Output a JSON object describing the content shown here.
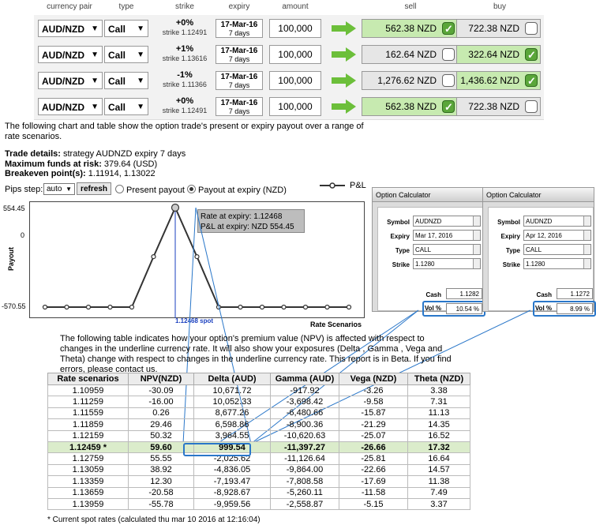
{
  "orders": {
    "headers": [
      "currency pair",
      "type",
      "strike",
      "expiry",
      "amount",
      "sell",
      "buy"
    ],
    "rows": [
      {
        "pair": "AUD/NZD",
        "type": "Call",
        "pct": "+0%",
        "strike": "strike 1.12491",
        "exp_date": "17-Mar-16",
        "exp_days": "7 days",
        "amount": "100,000",
        "sell": "562.38 NZD",
        "buy": "722.38 NZD",
        "sell_checked": true,
        "buy_checked": false
      },
      {
        "pair": "AUD/NZD",
        "type": "Call",
        "pct": "+1%",
        "strike": "strike 1.13616",
        "exp_date": "17-Mar-16",
        "exp_days": "7 days",
        "amount": "100,000",
        "sell": "162.64 NZD",
        "buy": "322.64 NZD",
        "sell_checked": false,
        "buy_checked": true
      },
      {
        "pair": "AUD/NZD",
        "type": "Call",
        "pct": "-1%",
        "strike": "strike 1.11366",
        "exp_date": "17-Mar-16",
        "exp_days": "7 days",
        "amount": "100,000",
        "sell": "1,276.62 NZD",
        "buy": "1,436.62 NZD",
        "sell_checked": false,
        "buy_checked": true
      },
      {
        "pair": "AUD/NZD",
        "type": "Call",
        "pct": "+0%",
        "strike": "strike 1.12491",
        "exp_date": "17-Mar-16",
        "exp_days": "7 days",
        "amount": "100,000",
        "sell": "562.38 NZD",
        "buy": "722.38 NZD",
        "sell_checked": true,
        "buy_checked": false
      }
    ]
  },
  "intro": "The following chart and table show the option trade's present or expiry payout over a range of rate scenarios.",
  "details": {
    "trade_label": "Trade details:",
    "trade_value": " strategy AUDNZD expiry 7 days",
    "funds_label": "Maximum funds at risk:",
    "funds_value": " 379.64 (USD)",
    "breakeven_label": "Breakeven point(s):",
    "breakeven_value": " 1.11914, 1.13022"
  },
  "controls": {
    "pips_label": "Pips step:",
    "pips_value": "auto",
    "refresh": "refresh",
    "present": "Present payout",
    "expiry": "Payout at expiry (NZD)",
    "legend": "P&L"
  },
  "chart_data": {
    "type": "line",
    "ylabel": "Payout",
    "xlabel": "Rate Scenarios",
    "y_ticks": [
      "554.45",
      "0",
      "-570.55"
    ],
    "ylim": [
      -570.55,
      554.45
    ],
    "spot_label": "1.12468 spot",
    "tooltip": [
      "Rate at expiry: 1.12468",
      "P&L at expiry: NZD 554.45"
    ],
    "x": [
      1,
      2,
      3,
      4,
      5,
      6,
      7,
      8,
      9,
      10,
      11,
      12,
      13,
      14,
      15
    ],
    "values": [
      -570.55,
      -570.55,
      -570.55,
      -570.55,
      -570.55,
      0,
      554.45,
      0,
      -570.55,
      -570.55,
      -570.55,
      -570.55,
      -570.55,
      -570.55,
      -570.55
    ],
    "spot_index": 6,
    "color": "#333333",
    "spot_color": "#1a3fbf"
  },
  "calc1": {
    "title": "Option Calculator",
    "symbol_l": "Symbol",
    "symbol": "AUDNZD",
    "expiry_l": "Expiry",
    "expiry": "Mar 17, 2016",
    "type_l": "Type",
    "type": "CALL",
    "strike_l": "Strike",
    "strike": "1.1280",
    "cash_l": "Cash",
    "cash": "1.1282",
    "vol_l": "Vol %",
    "vol": "10.54 %"
  },
  "calc2": {
    "title": "Option Calculator",
    "symbol_l": "Symbol",
    "symbol": "AUDNZD",
    "expiry_l": "Expiry",
    "expiry": "Apr 12, 2016",
    "type_l": "Type",
    "type": "CALL",
    "strike_l": "Strike",
    "strike": "1.1280",
    "cash_l": "Cash",
    "cash": "1.1272",
    "vol_l": "Vol %",
    "vol": "8.99 %"
  },
  "npv_text": "The following table indicates how your option's premium value (NPV) is affected with respect to changes in the underline currency rate. It will also show your exposures (Delta , Gamma , Vega and Theta) change with respect to changes in the underline currency rate. This report is in Beta. If you find errors, please contact us.",
  "table": {
    "headers": [
      "Rate scenarios",
      "NPV(NZD)",
      "Delta (AUD)",
      "Gamma (AUD)",
      "Vega (NZD)",
      "Theta (NZD)"
    ],
    "rows": [
      [
        "1.10959",
        "-30.09",
        "10,671.72",
        "-917.92",
        "-3.26",
        "3.38"
      ],
      [
        "1.11259",
        "-16.00",
        "10,052.33",
        "-3,698.42",
        "-9.58",
        "7.31"
      ],
      [
        "1.11559",
        "0.26",
        "8,677.26",
        "-6,480.66",
        "-15.87",
        "11.13"
      ],
      [
        "1.11859",
        "29.46",
        "6,598.86",
        "-8,900.36",
        "-21.29",
        "14.35"
      ],
      [
        "1.12159",
        "50.32",
        "3,964.55",
        "-10,620.63",
        "-25.07",
        "16.52"
      ],
      [
        "1.12459 *",
        "59.60",
        "999.54",
        "-11,397.27",
        "-26.66",
        "17.32"
      ],
      [
        "1.12759",
        "55.55",
        "-2,025.62",
        "-11,126.64",
        "-25.81",
        "16.64"
      ],
      [
        "1.13059",
        "38.92",
        "-4,836.05",
        "-9,864.00",
        "-22.66",
        "14.57"
      ],
      [
        "1.13359",
        "12.30",
        "-7,193.47",
        "-7,808.58",
        "-17.69",
        "11.38"
      ],
      [
        "1.13659",
        "-20.58",
        "-8,928.67",
        "-5,260.11",
        "-11.58",
        "7.49"
      ],
      [
        "1.13959",
        "-55.78",
        "-9,959.56",
        "-2,558.87",
        "-5.15",
        "3.37"
      ]
    ],
    "spot_row": 5
  },
  "footnote": "* Current spot rates (calculated thu mar 10 2016 at 12:16:04)"
}
